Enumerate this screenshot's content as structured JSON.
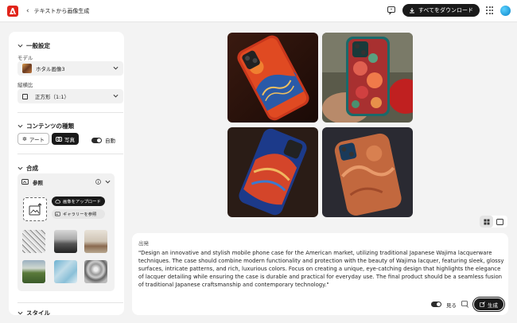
{
  "topbar": {
    "breadcrumb": "テキストから画像生成",
    "download_all": "すべてをダウンロード"
  },
  "panel": {
    "general_title": "一般設定",
    "model_label": "モデル",
    "model_value": "ホタル画像3",
    "aspect_label": "縦横比",
    "aspect_value": "正方形（1:1）",
    "content_title": "コンテンツの種類",
    "content_art": "アート",
    "content_photo": "写真",
    "content_auto": "自動",
    "compose_title": "合成",
    "reference_label": "参照",
    "upload_btn": "画像をアップロード",
    "gallery_btn": "ギャラリーを参照",
    "style_title": "スタイル"
  },
  "prompt": {
    "label": "出発",
    "text": "\"Design an innovative and stylish mobile phone case for the American market, utilizing traditional Japanese Wajima lacquerware techniques. The case should combine modern functionality and protection with the beauty of Wajima lacquer, featuring sleek, glossy surfaces, intricate patterns, and rich, luxurious colors. Focus on creating a unique, eye-catching design that highlights the elegance of lacquer detailing while ensuring the case is durable and practical for everyday use. The final product should be a seamless fusion of traditional Japanese craftsmanship and contemporary technology.\"",
    "see_label": "見る",
    "generate": "生成"
  },
  "colors": {
    "accent": "#e1251b",
    "dark": "#1a1a1a"
  }
}
